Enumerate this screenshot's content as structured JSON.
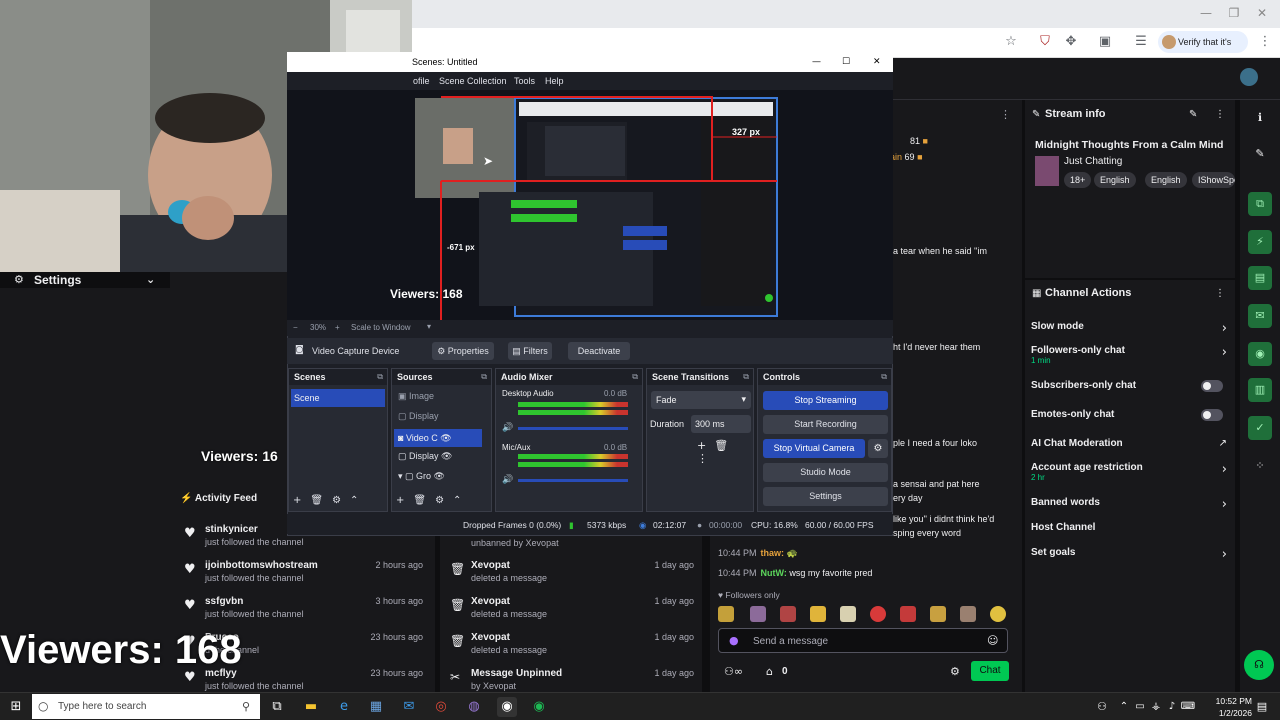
{
  "browser": {
    "verify_label": "Verify that it's you",
    "win_controls": [
      "—",
      "❐",
      "✕"
    ]
  },
  "webcam": {
    "settings_label": "Settings"
  },
  "obs": {
    "title": "Scenes: Untitled",
    "menu": [
      "ofile",
      "Scene Collection",
      "Tools",
      "Help"
    ],
    "preview": {
      "measure_label": "327 px",
      "measure_label_2": "-671 px",
      "viewers_small": "Viewers: 168"
    },
    "zoom": "30%",
    "scale_mode": "Scale to Window",
    "source_bar": {
      "source_name": "Video Capture Device",
      "properties": "Properties",
      "filters": "Filters",
      "deactivate": "Deactivate"
    },
    "docks": {
      "scenes": {
        "title": "Scenes",
        "items": [
          "Scene"
        ]
      },
      "sources": {
        "title": "Sources",
        "items": [
          "Image",
          "Display",
          "Video C",
          "Display",
          "Gro"
        ]
      },
      "mixer": {
        "title": "Audio Mixer",
        "channels": [
          {
            "name": "Desktop Audio",
            "db": "0.0 dB"
          },
          {
            "name": "Mic/Aux",
            "db": "0.0 dB"
          }
        ]
      },
      "transitions": {
        "title": "Scene Transitions",
        "type": "Fade",
        "duration_label": "Duration",
        "duration": "300 ms"
      },
      "controls": {
        "title": "Controls",
        "buttons": [
          "Stop Streaming",
          "Start Recording",
          "Stop Virtual Camera",
          "Studio Mode",
          "Settings"
        ]
      }
    },
    "status": {
      "dropped": "Dropped Frames 0 (0.0%)",
      "bitrate": "5373 kbps",
      "stream_time": "02:12:07",
      "rec_time": "00:00:00",
      "cpu": "CPU: 16.8%",
      "fps": "60.00 / 60.00 FPS"
    }
  },
  "activity_feed": {
    "title": "Activity Feed",
    "items": [
      {
        "name": "stinkynicer",
        "sub": "just followed the channel",
        "time": ""
      },
      {
        "name": "ijoinbottomswhostream",
        "sub": "just followed the channel",
        "time": "2 hours ago"
      },
      {
        "name": "ssfgvbn",
        "sub": "just followed the channel",
        "time": "3 hours ago"
      },
      {
        "name": "Pruceo",
        "sub": "d the channel",
        "time": "23 hours ago"
      },
      {
        "name": "mcflyy",
        "sub": "just followed the channel",
        "time": "23 hours ago"
      }
    ]
  },
  "mod_log": {
    "items": [
      {
        "name": "",
        "sub": "unbanned by Xevopat",
        "time": ""
      },
      {
        "name": "Xevopat",
        "sub": "deleted a message",
        "time": "1 day ago"
      },
      {
        "name": "Xevopat",
        "sub": "deleted a message",
        "time": "1 day ago"
      },
      {
        "name": "Xevopat",
        "sub": "deleted a message",
        "time": "1 day ago"
      },
      {
        "name": "Message Unpinned",
        "sub": "by Xevopat",
        "time": "1 day ago"
      }
    ]
  },
  "chat": {
    "leaderboard": [
      {
        "value": "81"
      },
      {
        "name": "ain",
        "value": "69"
      }
    ],
    "fragments": [
      "a tear when he said ''im",
      "ht I'd never hear them",
      "ple I need a four loko",
      "a sensai and pat here",
      "ery day",
      "like you'' i didnt think he'd",
      "sping every word"
    ],
    "messages": [
      {
        "time": "10:44 PM",
        "user": "thaw:",
        "text": "",
        "color": "#e6a23c"
      },
      {
        "time": "10:44 PM",
        "user": "NutW:",
        "text": "wsg my favorite pred",
        "color": "#5cd65c"
      }
    ],
    "followers_only": "Followers only",
    "input_placeholder": "Send a message",
    "points": "0",
    "chat_button": "Chat"
  },
  "stream_info": {
    "title": "Stream info",
    "stream_title": "Midnight Thoughts From a Calm Mind",
    "category": "Just Chatting",
    "tags": [
      "18+",
      "English",
      "English",
      "IShowSpe"
    ]
  },
  "channel_actions": {
    "title": "Channel Actions",
    "items": [
      {
        "label": "Slow mode",
        "sub": "",
        "control": "arrow"
      },
      {
        "label": "Followers-only chat",
        "sub": "1 min",
        "control": "arrow"
      },
      {
        "label": "Subscribers-only chat",
        "sub": "",
        "control": "toggle"
      },
      {
        "label": "Emotes-only chat",
        "sub": "",
        "control": "toggle"
      },
      {
        "label": "AI Chat Moderation",
        "sub": "",
        "control": "external"
      },
      {
        "label": "Account age restriction",
        "sub": "2 hr",
        "control": "arrow"
      },
      {
        "label": "Banned words",
        "sub": "",
        "control": "arrow"
      },
      {
        "label": "Host Channel",
        "sub": "",
        "control": "none"
      },
      {
        "label": "Set goals",
        "sub": "",
        "control": "arrow"
      }
    ]
  },
  "overlay": {
    "viewers": "Viewers: 168",
    "viewers_mid": "Viewers: 16"
  },
  "taskbar": {
    "search_placeholder": "Type here to search",
    "time": "10:52 PM",
    "date": "1/2/2026"
  }
}
